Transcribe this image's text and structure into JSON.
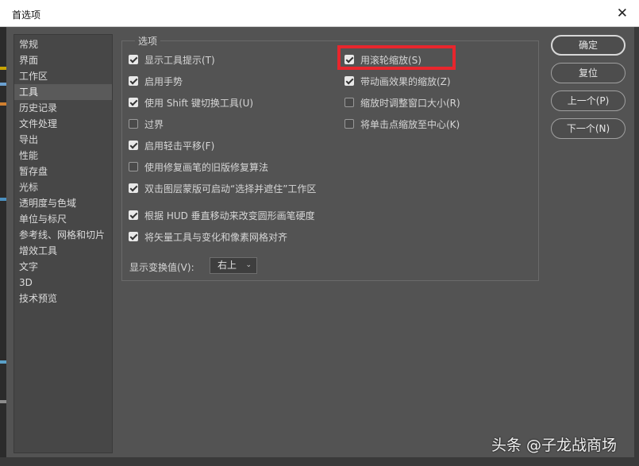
{
  "window": {
    "title": "首选项"
  },
  "sidebar": {
    "items": [
      {
        "label": "常规"
      },
      {
        "label": "界面"
      },
      {
        "label": "工作区"
      },
      {
        "label": "工具"
      },
      {
        "label": "历史记录"
      },
      {
        "label": "文件处理"
      },
      {
        "label": "导出"
      },
      {
        "label": "性能"
      },
      {
        "label": "暂存盘"
      },
      {
        "label": "光标"
      },
      {
        "label": "透明度与色域"
      },
      {
        "label": "单位与标尺"
      },
      {
        "label": "参考线、网格和切片"
      },
      {
        "label": "增效工具"
      },
      {
        "label": "文字"
      },
      {
        "label": "3D"
      },
      {
        "label": "技术预览"
      }
    ],
    "selected": "工具"
  },
  "options": {
    "group_label": "选项",
    "left": [
      {
        "label": "显示工具提示(T)",
        "checked": true
      },
      {
        "label": "启用手势",
        "checked": true
      },
      {
        "label": "使用 Shift 键切换工具(U)",
        "checked": true
      },
      {
        "label": "过界",
        "checked": false
      },
      {
        "label": "启用轻击平移(F)",
        "checked": true
      },
      {
        "label": "使用修复画笔的旧版修复算法",
        "checked": false
      },
      {
        "label": "双击图层蒙版可启动“选择并遮住”工作区",
        "checked": true
      },
      {
        "label": "根据 HUD 垂直移动来改变圆形画笔硬度",
        "checked": true
      },
      {
        "label": "将矢量工具与变化和像素网格对齐",
        "checked": true
      }
    ],
    "right": [
      {
        "label": "用滚轮缩放(S)",
        "checked": true
      },
      {
        "label": "带动画效果的缩放(Z)",
        "checked": true
      },
      {
        "label": "缩放时调整窗口大小(R)",
        "checked": false
      },
      {
        "label": "将单击点缩放至中心(K)",
        "checked": false
      }
    ],
    "transform_values": {
      "label": "显示变换值(V):",
      "value": "右上"
    }
  },
  "buttons": {
    "ok": "确定",
    "reset": "复位",
    "prev": "上一个(P)",
    "next": "下一个(N)"
  },
  "watermark": "头条 @子龙战商场",
  "colors": {
    "highlight": "#e8262d",
    "dialog_bg": "#535353"
  }
}
